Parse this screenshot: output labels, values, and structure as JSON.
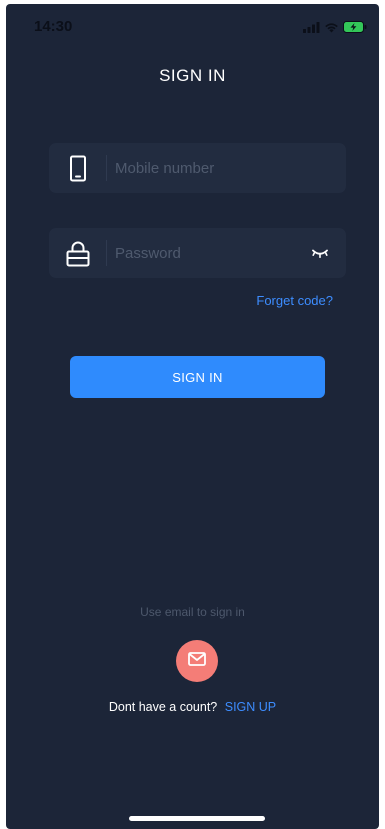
{
  "status_bar": {
    "time": "14:30",
    "icons": [
      "cellular-signal-icon",
      "wifi-icon",
      "battery-charging-icon"
    ],
    "battery_color": "#33c759"
  },
  "header": {
    "title": "SIGN IN"
  },
  "form": {
    "mobile": {
      "icon": "phone-icon",
      "placeholder": "Mobile number",
      "value": ""
    },
    "password": {
      "icon": "lock-icon",
      "placeholder": "Password",
      "value": "",
      "toggle_icon": "eye-closed-icon"
    },
    "forget_label": "Forget code?",
    "submit_label": "SIGN IN"
  },
  "alt_signin": {
    "hint": "Use email to sign in",
    "icon": "mail-icon",
    "button_color": "#f47d77"
  },
  "signup": {
    "prompt": "Dont have a count?",
    "link_label": "SIGN UP"
  },
  "colors": {
    "background": "#1c2538",
    "field": "#222c40",
    "accent": "#2f8bfd",
    "link": "#3d8dff"
  }
}
